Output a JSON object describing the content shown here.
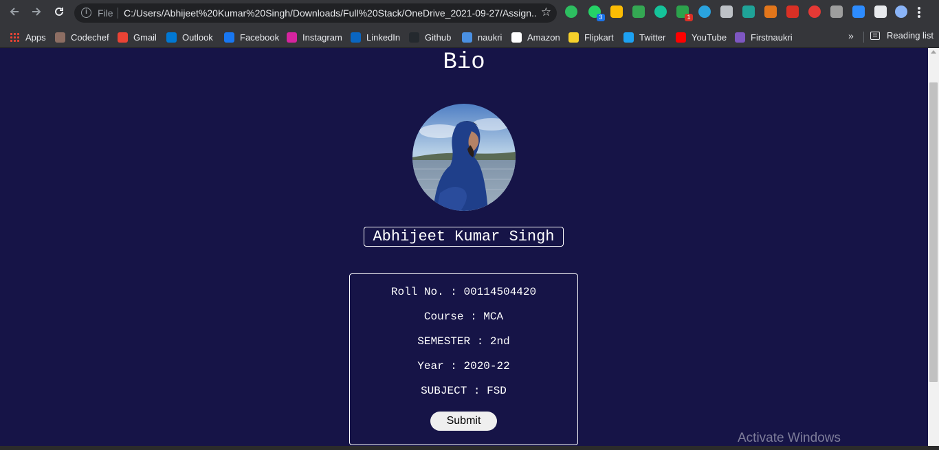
{
  "browser": {
    "omnibox": {
      "scheme": "File",
      "url": "C:/Users/Abhijeet%20Kumar%20Singh/Downloads/Full%20Stack/OneDrive_2021-09-27/Assign..."
    },
    "extensions": [
      {
        "name": "evernote-icon",
        "color": "#2dbe60"
      },
      {
        "name": "whatsapp-icon",
        "color": "#25d366",
        "badge": "3",
        "badge_color": "#1a73e8"
      },
      {
        "name": "speed-dial-icon",
        "color": "#fbbc04"
      },
      {
        "name": "google-drive-icon",
        "color": "#34a853"
      },
      {
        "name": "grammarly-icon",
        "color": "#15c39a"
      },
      {
        "name": "extension-green-icon",
        "color": "#2ca24c",
        "badge": "1",
        "badge_color": "#d93025"
      },
      {
        "name": "telegram-icon",
        "color": "#2aa3df"
      },
      {
        "name": "extension-grey-icon",
        "color": "#bdc1c6"
      },
      {
        "name": "extension-teal-icon",
        "color": "#1fa398"
      },
      {
        "name": "metamask-icon",
        "color": "#e2761b"
      },
      {
        "name": "calendar-icon",
        "color": "#d93025"
      },
      {
        "name": "pokeball-icon",
        "color": "#e53935"
      },
      {
        "name": "pdf-icon",
        "color": "#9e9e9e"
      },
      {
        "name": "zoom-icon",
        "color": "#2d8cff"
      },
      {
        "name": "puzzle-icon",
        "color": "#e8eaed"
      },
      {
        "name": "profile-avatar-icon",
        "color": "#8ab4f8"
      },
      {
        "name": "menu-kebab-icon",
        "color": "#e8eaed"
      }
    ],
    "bookmarks": [
      {
        "label": "Apps",
        "icon": "apps-grid-icon",
        "color": "#ea4335"
      },
      {
        "label": "Codechef",
        "icon": "codechef-icon",
        "color": "#8d6e63"
      },
      {
        "label": "Gmail",
        "icon": "gmail-icon",
        "color": "#ea4335"
      },
      {
        "label": "Outlook",
        "icon": "outlook-icon",
        "color": "#0078d4"
      },
      {
        "label": "Facebook",
        "icon": "facebook-icon",
        "color": "#1877f2"
      },
      {
        "label": "Instagram",
        "icon": "instagram-icon",
        "color": "#d6249f"
      },
      {
        "label": "LinkedIn",
        "icon": "linkedin-icon",
        "color": "#0a66c2"
      },
      {
        "label": "Github",
        "icon": "github-icon",
        "color": "#24292e"
      },
      {
        "label": "naukri",
        "icon": "naukri-icon",
        "color": "#4a90e2"
      },
      {
        "label": "Amazon",
        "icon": "amazon-icon",
        "color": "#ffffff"
      },
      {
        "label": "Flipkart",
        "icon": "flipkart-icon",
        "color": "#f7d12b"
      },
      {
        "label": "Twitter",
        "icon": "twitter-icon",
        "color": "#1da1f2"
      },
      {
        "label": "YouTube",
        "icon": "youtube-icon",
        "color": "#ff0000"
      },
      {
        "label": "Firstnaukri",
        "icon": "firstnaukri-icon",
        "color": "#7e57c2"
      }
    ],
    "bookmarks_overflow": "»",
    "reading_list": "Reading list"
  },
  "page": {
    "title": "Bio",
    "name": "Abhijeet Kumar Singh",
    "details": [
      "Roll No. : 00114504420",
      "Course : MCA",
      "SEMESTER : 2nd",
      "Year : 2020-22",
      "SUBJECT : FSD"
    ],
    "submit_label": "Submit",
    "background": "#161447"
  },
  "os": {
    "watermark": "Activate Windows"
  }
}
